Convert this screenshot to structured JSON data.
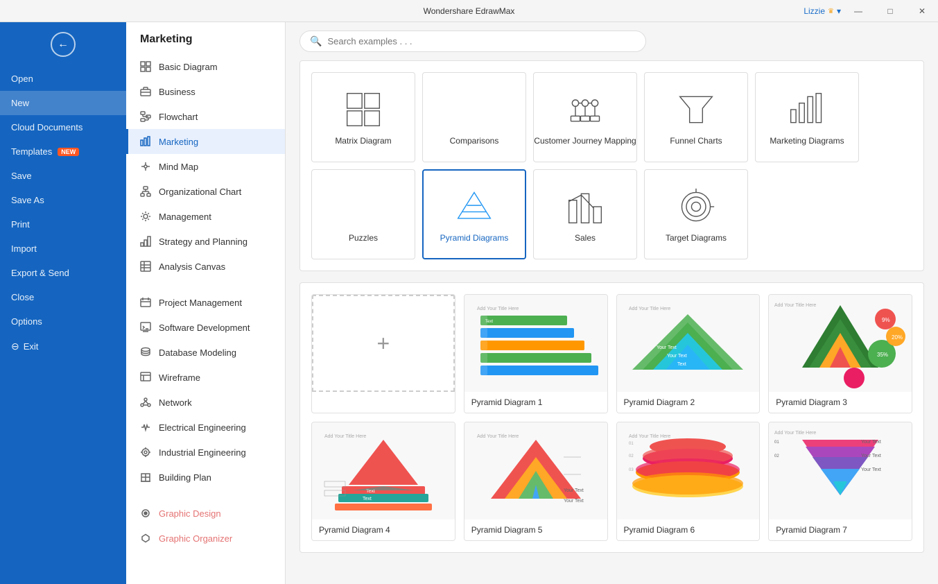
{
  "titlebar": {
    "title": "Wondershare EdrawMax",
    "user": "Lizzie",
    "minimize": "—",
    "maximize": "□",
    "close": "✕"
  },
  "sidebar": {
    "back_label": "←",
    "items": [
      {
        "id": "open",
        "label": "Open"
      },
      {
        "id": "new",
        "label": "New",
        "active": false
      },
      {
        "id": "cloud",
        "label": "Cloud Documents"
      },
      {
        "id": "templates",
        "label": "Templates",
        "badge": "NEW"
      },
      {
        "id": "save",
        "label": "Save"
      },
      {
        "id": "saveas",
        "label": "Save As"
      },
      {
        "id": "print",
        "label": "Print"
      },
      {
        "id": "import",
        "label": "Import"
      },
      {
        "id": "export",
        "label": "Export & Send"
      },
      {
        "id": "close",
        "label": "Close"
      },
      {
        "id": "options",
        "label": "Options"
      },
      {
        "id": "exit",
        "label": "Exit"
      }
    ]
  },
  "middle_nav": {
    "title": "Marketing",
    "items": [
      {
        "id": "basic",
        "label": "Basic Diagram",
        "icon": "grid"
      },
      {
        "id": "business",
        "label": "Business",
        "icon": "briefcase"
      },
      {
        "id": "flowchart",
        "label": "Flowchart",
        "icon": "flow"
      },
      {
        "id": "marketing",
        "label": "Marketing",
        "icon": "chart",
        "active": true
      },
      {
        "id": "mindmap",
        "label": "Mind Map",
        "icon": "mind"
      },
      {
        "id": "orgchart",
        "label": "Organizational Chart",
        "icon": "org"
      },
      {
        "id": "management",
        "label": "Management",
        "icon": "gear"
      },
      {
        "id": "strategy",
        "label": "Strategy and Planning",
        "icon": "strategy"
      },
      {
        "id": "analysis",
        "label": "Analysis Canvas",
        "icon": "canvas"
      },
      {
        "id": "project",
        "label": "Project Management",
        "icon": "project"
      },
      {
        "id": "software",
        "label": "Software Development",
        "icon": "software"
      },
      {
        "id": "database",
        "label": "Database Modeling",
        "icon": "db"
      },
      {
        "id": "wireframe",
        "label": "Wireframe",
        "icon": "wire"
      },
      {
        "id": "network",
        "label": "Network",
        "icon": "network"
      },
      {
        "id": "electrical",
        "label": "Electrical Engineering",
        "icon": "electrical"
      },
      {
        "id": "industrial",
        "label": "Industrial Engineering",
        "icon": "industrial"
      },
      {
        "id": "building",
        "label": "Building Plan",
        "icon": "building"
      },
      {
        "id": "graphic",
        "label": "Graphic Design",
        "icon": "graphic",
        "special": true
      },
      {
        "id": "organizer",
        "label": "Graphic Organizer",
        "icon": "organizer",
        "special": true
      }
    ]
  },
  "search": {
    "placeholder": "Search examples . . ."
  },
  "categories": [
    {
      "id": "matrix",
      "label": "Matrix Diagram",
      "icon": "matrix"
    },
    {
      "id": "comparisons",
      "label": "Comparisons",
      "icon": "compare"
    },
    {
      "id": "customer",
      "label": "Customer Journey Mapping",
      "icon": "customer"
    },
    {
      "id": "funnel",
      "label": "Funnel Charts",
      "icon": "funnel"
    },
    {
      "id": "marketing",
      "label": "Marketing Diagrams",
      "icon": "marketing"
    },
    {
      "id": "puzzles",
      "label": "Puzzles",
      "icon": "puzzle"
    },
    {
      "id": "pyramid",
      "label": "Pyramid Diagrams",
      "icon": "pyramid",
      "active": true
    },
    {
      "id": "sales",
      "label": "Sales",
      "icon": "sales"
    },
    {
      "id": "target",
      "label": "Target Diagrams",
      "icon": "target"
    }
  ],
  "diagrams": [
    {
      "id": "new",
      "label": "",
      "is_new": true
    },
    {
      "id": "d1",
      "label": "Pyramid Diagram 1",
      "color1": "#4caf50",
      "color2": "#2196f3",
      "color3": "#ff9800"
    },
    {
      "id": "d2",
      "label": "Pyramid Diagram 2",
      "color1": "#66bb6a",
      "color2": "#26c6da"
    },
    {
      "id": "d3",
      "label": "Pyramid Diagram 3",
      "color1": "#e53935",
      "color2": "#43a047",
      "color3": "#ffa726"
    },
    {
      "id": "d4",
      "label": "Pyramid Diagram 4",
      "color1": "#ef5350",
      "color2": "#26a69a",
      "color3": "#ff7043"
    },
    {
      "id": "d5",
      "label": "Pyramid Diagram 5",
      "color1": "#ef5350",
      "color2": "#ffa726"
    },
    {
      "id": "d6",
      "label": "Pyramid Diagram 6",
      "color1": "#ef5350",
      "color2": "#e91e63",
      "color3": "#ff9800"
    },
    {
      "id": "d7",
      "label": "Pyramid Diagram 7",
      "color1": "#ec407a",
      "color2": "#ab47bc",
      "color3": "#7e57c2"
    }
  ]
}
